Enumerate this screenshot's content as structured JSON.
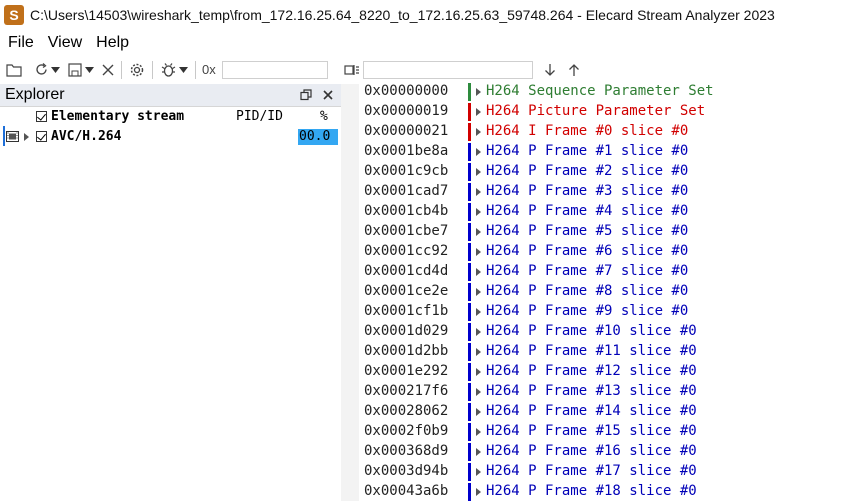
{
  "window": {
    "title": "C:\\Users\\14503\\wireshark_temp\\from_172.16.25.64_8220_to_172.16.25.63_59748.264 - Elecard Stream Analyzer 2023",
    "app_icon_letter": "S"
  },
  "menu": [
    "File",
    "View",
    "Help"
  ],
  "toolbar": {
    "hex_prefix": "0x",
    "offset_value": "",
    "search_value": ""
  },
  "explorer": {
    "title": "Explorer",
    "columns": {
      "name": "Elementary stream",
      "pid": "PID/ID",
      "percent": "%"
    },
    "tree": [
      {
        "label": "AVC/H.264",
        "percent": "00.0"
      }
    ]
  },
  "colors": {
    "sps": "#2e8b3e",
    "pps": "#d10000",
    "i_frame": "#d10000",
    "p_frame": "#0000cc",
    "label_sps": "#2e7d32",
    "label_red": "#d10000",
    "label_blue": "#0000b8",
    "highlight": "#33a7f2"
  },
  "stream": [
    {
      "address": "0x00000000",
      "label": "H264 Sequence Parameter Set",
      "kind": "sps"
    },
    {
      "address": "0x00000019",
      "label": "H264 Picture Parameter Set",
      "kind": "pps"
    },
    {
      "address": "0x00000021",
      "label": "H264 I Frame #0 slice #0",
      "kind": "i"
    },
    {
      "address": "0x0001be8a",
      "label": "H264 P Frame #1 slice #0",
      "kind": "p"
    },
    {
      "address": "0x0001c9cb",
      "label": "H264 P Frame #2 slice #0",
      "kind": "p"
    },
    {
      "address": "0x0001cad7",
      "label": "H264 P Frame #3 slice #0",
      "kind": "p"
    },
    {
      "address": "0x0001cb4b",
      "label": "H264 P Frame #4 slice #0",
      "kind": "p"
    },
    {
      "address": "0x0001cbe7",
      "label": "H264 P Frame #5 slice #0",
      "kind": "p"
    },
    {
      "address": "0x0001cc92",
      "label": "H264 P Frame #6 slice #0",
      "kind": "p"
    },
    {
      "address": "0x0001cd4d",
      "label": "H264 P Frame #7 slice #0",
      "kind": "p"
    },
    {
      "address": "0x0001ce2e",
      "label": "H264 P Frame #8 slice #0",
      "kind": "p"
    },
    {
      "address": "0x0001cf1b",
      "label": "H264 P Frame #9 slice #0",
      "kind": "p"
    },
    {
      "address": "0x0001d029",
      "label": "H264 P Frame #10 slice #0",
      "kind": "p"
    },
    {
      "address": "0x0001d2bb",
      "label": "H264 P Frame #11 slice #0",
      "kind": "p"
    },
    {
      "address": "0x0001e292",
      "label": "H264 P Frame #12 slice #0",
      "kind": "p"
    },
    {
      "address": "0x000217f6",
      "label": "H264 P Frame #13 slice #0",
      "kind": "p"
    },
    {
      "address": "0x00028062",
      "label": "H264 P Frame #14 slice #0",
      "kind": "p"
    },
    {
      "address": "0x0002f0b9",
      "label": "H264 P Frame #15 slice #0",
      "kind": "p"
    },
    {
      "address": "0x000368d9",
      "label": "H264 P Frame #16 slice #0",
      "kind": "p"
    },
    {
      "address": "0x0003d94b",
      "label": "H264 P Frame #17 slice #0",
      "kind": "p"
    },
    {
      "address": "0x00043a6b",
      "label": "H264 P Frame #18 slice #0",
      "kind": "p"
    }
  ]
}
